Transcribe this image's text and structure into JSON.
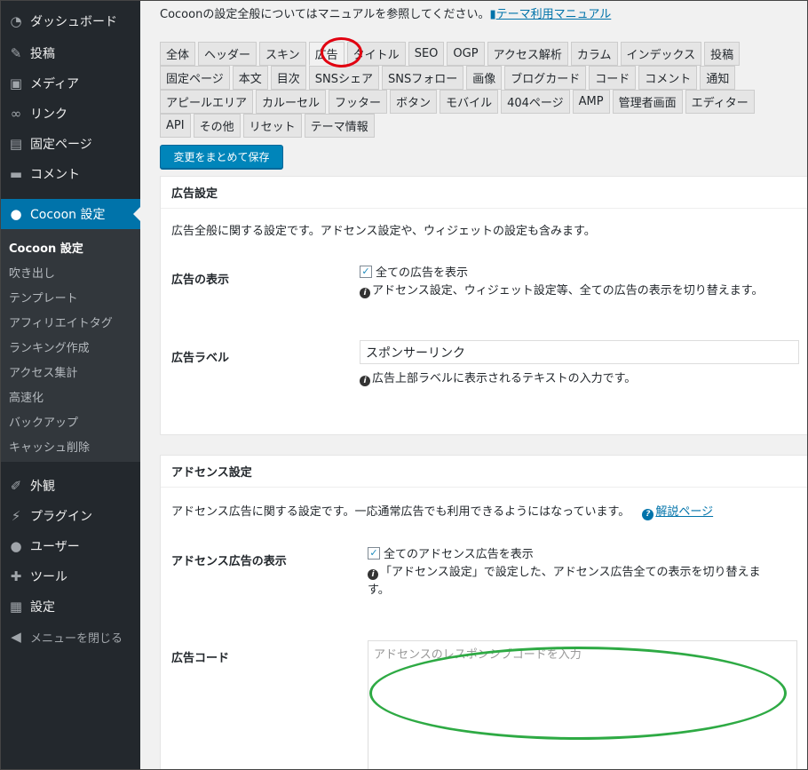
{
  "sidebar": {
    "items": [
      {
        "label": "ダッシュボード",
        "icon": "dashboard-icon"
      },
      {
        "label": "投稿",
        "icon": "pin-icon"
      },
      {
        "label": "メディア",
        "icon": "media-icon"
      },
      {
        "label": "リンク",
        "icon": "link-icon"
      },
      {
        "label": "固定ページ",
        "icon": "page-icon"
      },
      {
        "label": "コメント",
        "icon": "comment-icon"
      }
    ],
    "current": {
      "label": "Cocoon 設定",
      "icon": "cocoon-icon"
    },
    "submenu": [
      "Cocoon 設定",
      "吹き出し",
      "テンプレート",
      "アフィリエイトタグ",
      "ランキング作成",
      "アクセス集計",
      "高速化",
      "バックアップ",
      "キャッシュ削除"
    ],
    "items2": [
      {
        "label": "外観",
        "icon": "brush-icon"
      },
      {
        "label": "プラグイン",
        "icon": "plugin-icon"
      },
      {
        "label": "ユーザー",
        "icon": "user-icon"
      },
      {
        "label": "ツール",
        "icon": "wrench-icon"
      },
      {
        "label": "設定",
        "icon": "settings-icon"
      }
    ],
    "collapse": "メニューを閉じる"
  },
  "notice": {
    "text": "Cocoonの設定全般についてはマニュアルを参照してください。",
    "link": "テーマ利用マニュアル"
  },
  "tabs": [
    [
      "全体",
      "ヘッダー",
      "スキン",
      "広告",
      "タイトル",
      "SEO",
      "OGP",
      "アクセス解析",
      "カラム",
      "インデックス",
      "投稿"
    ],
    [
      "固定ページ",
      "本文",
      "目次",
      "SNSシェア",
      "SNSフォロー",
      "画像",
      "ブログカード",
      "コード",
      "コメント",
      "通知"
    ],
    [
      "アピールエリア",
      "カルーセル",
      "フッター",
      "ボタン",
      "モバイル",
      "404ページ",
      "AMP",
      "管理者画面",
      "エディター"
    ],
    [
      "API",
      "その他",
      "リセット",
      "テーマ情報"
    ]
  ],
  "active_tab": "広告",
  "save_button": "変更をまとめて保存",
  "ad_panel": {
    "title": "広告設定",
    "desc": "広告全般に関する設定です。アドセンス設定や、ウィジェットの設定も含みます。",
    "display_label": "広告の表示",
    "display_check": "全ての広告を表示",
    "display_checked": true,
    "display_hint": "アドセンス設定、ウィジェット設定等、全ての広告の表示を切り替えます。",
    "label_label": "広告ラベル",
    "label_value": "スポンサーリンク",
    "label_hint": "広告上部ラベルに表示されるテキストの入力です。"
  },
  "adsense_panel": {
    "title": "アドセンス設定",
    "desc": "アドセンス広告に関する設定です。一応通常広告でも利用できるようにはなっています。",
    "help_link": "解説ページ",
    "display_label": "アドセンス広告の表示",
    "display_check": "全てのアドセンス広告を表示",
    "display_checked": true,
    "display_hint_1": "「アドセンス設定」で設定した、アドセンス広告全ての表示を切り替えま",
    "display_hint_2": "す。",
    "code_label": "広告コード",
    "code_placeholder": "アドセンスのレスポンシブコードを入力"
  }
}
